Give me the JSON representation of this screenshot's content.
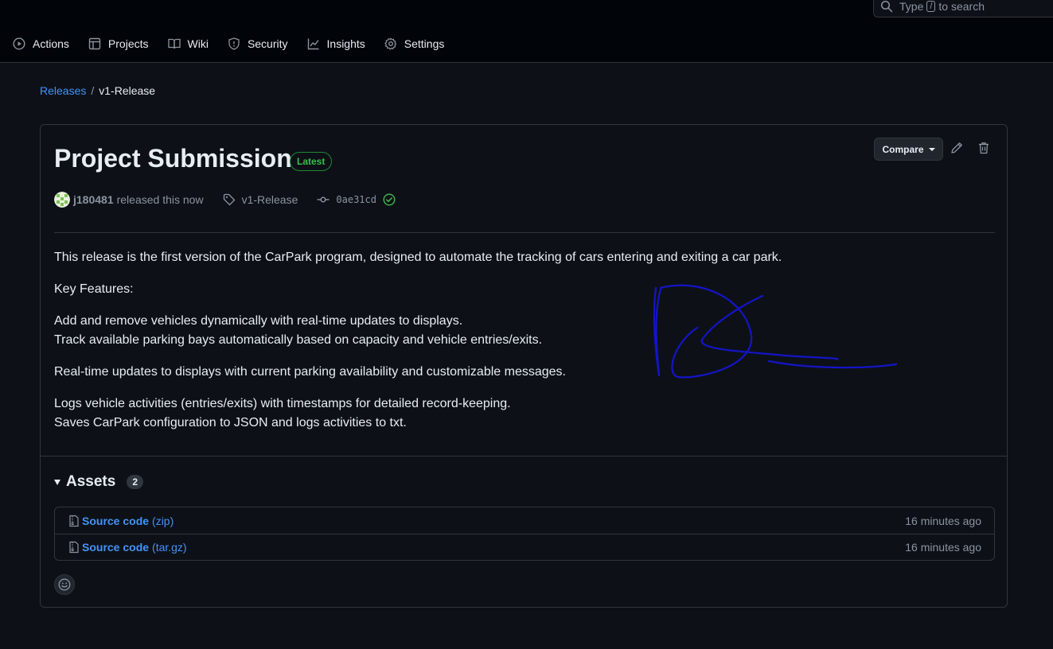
{
  "search": {
    "prefix": "Type",
    "key": "/",
    "suffix": "to search"
  },
  "nav": {
    "items": [
      {
        "label": "Actions",
        "icon": "play-icon"
      },
      {
        "label": "Projects",
        "icon": "table-icon"
      },
      {
        "label": "Wiki",
        "icon": "book-icon"
      },
      {
        "label": "Security",
        "icon": "shield-icon"
      },
      {
        "label": "Insights",
        "icon": "graph-icon"
      },
      {
        "label": "Settings",
        "icon": "gear-icon"
      }
    ]
  },
  "breadcrumb": {
    "root": "Releases",
    "separator": "/",
    "current": "v1-Release"
  },
  "release": {
    "title": "Project Submission",
    "badge": "Latest",
    "compare_label": "Compare",
    "author": "j180481",
    "released_text": "released this now",
    "tag": "v1-Release",
    "commit": "0ae31cd",
    "body": {
      "intro": "This release is the first version of the CarPark program, designed to automate the tracking of cars entering and exiting a car park.",
      "features_heading": "Key Features:",
      "feature_1": "Add and remove vehicles dynamically with real-time updates to displays.",
      "feature_2": "Track available parking bays automatically based on capacity and vehicle entries/exits.",
      "feature_3": "Real-time updates to displays with current parking availability and customizable messages.",
      "feature_4": "Logs vehicle activities (entries/exits) with timestamps for detailed record-keeping.",
      "feature_5": "Saves CarPark configuration to JSON and logs activities to txt."
    }
  },
  "assets": {
    "title": "Assets",
    "count": "2",
    "items": [
      {
        "name": "Source code",
        "ext": "(zip)",
        "time": "16 minutes ago"
      },
      {
        "name": "Source code",
        "ext": "(tar.gz)",
        "time": "16 minutes ago"
      }
    ]
  },
  "colors": {
    "background": "#0d1117",
    "header": "#010409",
    "link": "#4493f8",
    "latest_green": "#3fb950",
    "signature_blue": "#1414c8"
  }
}
